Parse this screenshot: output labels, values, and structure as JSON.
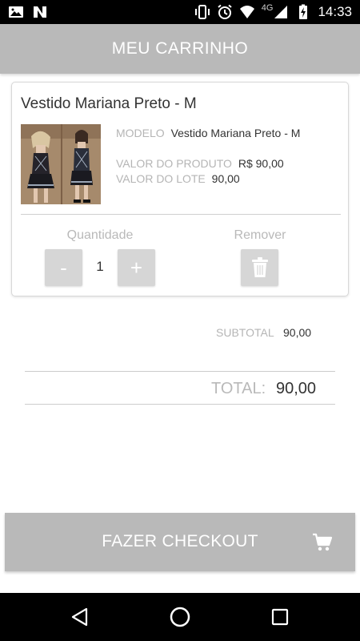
{
  "status_bar": {
    "time": "14:33",
    "network": "4G",
    "icons": [
      "image-icon",
      "n-app-icon",
      "vibrate-icon",
      "alarm-icon",
      "wifi-icon",
      "signal-icon",
      "battery-charging-icon"
    ]
  },
  "header": {
    "title": "MEU CARRINHO"
  },
  "cart": {
    "items": [
      {
        "name": "Vestido Mariana Preto - M",
        "modelo_label": "MODELO",
        "modelo_value": "Vestido Mariana Preto - M",
        "valor_produto_label": "VALOR DO PRODUTO",
        "valor_produto_value": "R$ 90,00",
        "valor_lote_label": "VALOR DO LOTE",
        "valor_lote_value": "90,00",
        "quantidade_label": "Quantidade",
        "quantidade": "1",
        "minus_label": "-",
        "plus_label": "+",
        "remover_label": "Remover"
      }
    ]
  },
  "totals": {
    "subtotal_label": "SUBTOTAL",
    "subtotal_value": "90,00",
    "total_label": "TOTAL:",
    "total_value": "90,00"
  },
  "checkout": {
    "label": "FAZER CHECKOUT",
    "icon": "cart-icon"
  },
  "nav_bar": {
    "buttons": [
      "back-icon",
      "home-icon",
      "recents-icon"
    ]
  },
  "colors": {
    "header_bg": "#b9b9b9",
    "button_bg": "#d6d6d6",
    "label_gray": "#b5b5b5",
    "text_dark": "#333333"
  }
}
